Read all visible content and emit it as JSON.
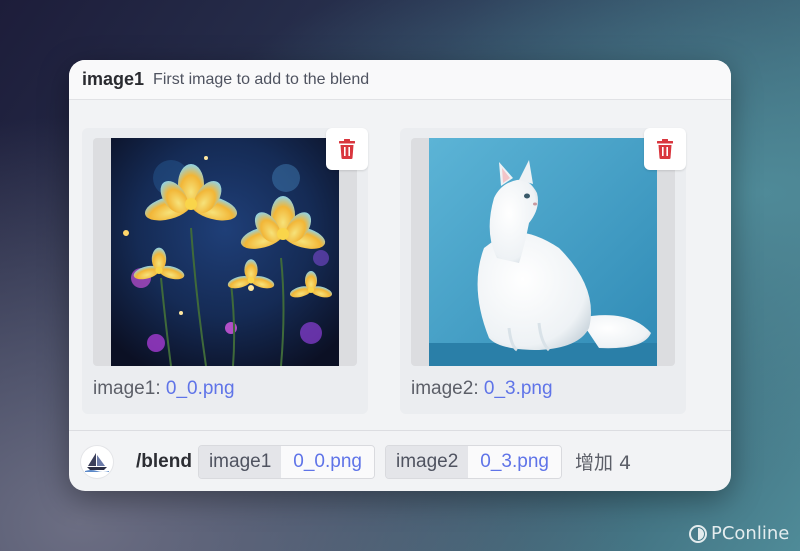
{
  "option_header": {
    "name": "image1",
    "description": "First image to add to the blend"
  },
  "attachments": [
    {
      "caption_label": "image1:",
      "filename": "0_0.png",
      "thumbnail": "glowing-flowers-image",
      "delete_icon": "trash-icon"
    },
    {
      "caption_label": "image2:",
      "filename": "0_3.png",
      "thumbnail": "white-cat-image",
      "delete_icon": "trash-icon"
    }
  ],
  "command_bar": {
    "bot_icon": "sailboat-bot-avatar",
    "command": "/blend",
    "options": [
      {
        "name": "image1",
        "value": "0_0.png"
      },
      {
        "name": "image2",
        "value": "0_3.png"
      }
    ],
    "more_label": "增加 4"
  },
  "watermark": {
    "text": "PConline"
  },
  "colors": {
    "accent_link": "#5f74e8",
    "delete_red": "#d9363e",
    "card_bg": "#f2f3f5"
  }
}
